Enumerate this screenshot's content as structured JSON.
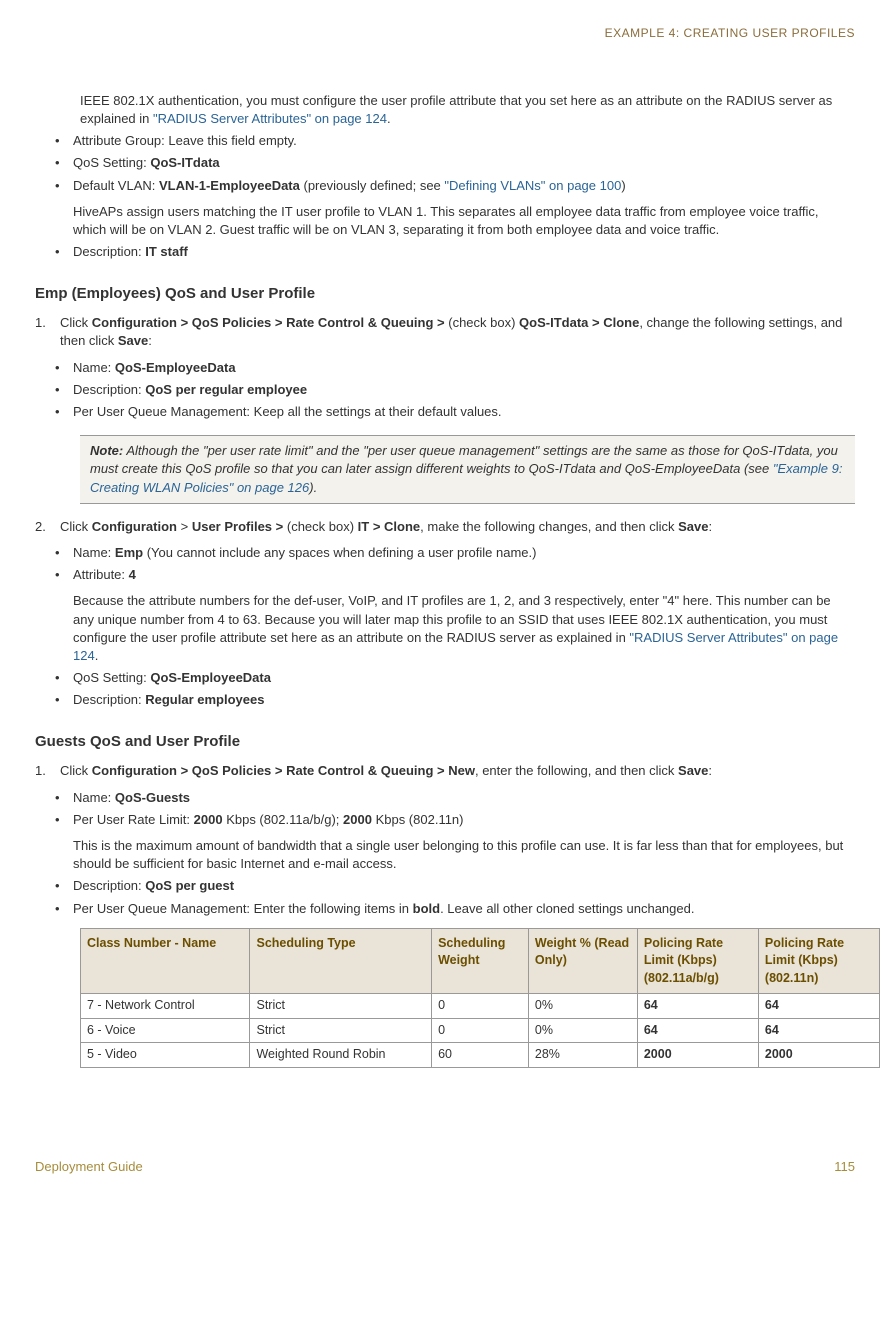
{
  "header": {
    "right": "EXAMPLE 4: CREATING USER PROFILES"
  },
  "intro": {
    "p1a": "IEEE 802.1X authentication, you must configure the user profile attribute that you set here as an attribute on the RADIUS server as explained in ",
    "p1link": "\"RADIUS Server Attributes\" on page 124",
    "p1b": "."
  },
  "bullets1": {
    "b1": "Attribute Group: Leave this field empty.",
    "b2a": "QoS Setting: ",
    "b2b": "QoS-ITdata",
    "b3a": "Default VLAN: ",
    "b3b": "VLAN-1-EmployeeData",
    "b3c": " (previously defined; see ",
    "b3link": "\"Defining VLANs\" on page 100",
    "b3d": ")",
    "b3p": "HiveAPs assign users matching the IT user profile to VLAN 1. This separates all employee data traffic from employee voice traffic, which will be on VLAN 2. Guest traffic will be on VLAN 3, separating it from both employee data and voice traffic.",
    "b4a": "Description: ",
    "b4b": "IT staff"
  },
  "sec1": {
    "title": "Emp (Employees) QoS and User Profile",
    "n1a": "Click ",
    "n1b": "Configuration > QoS Policies > Rate Control & Queuing > ",
    "n1c": "(check box) ",
    "n1d": "QoS-ITdata > Clone",
    "n1e": ", change the following settings, and then click ",
    "n1f": "Save",
    "n1g": ":",
    "s1a": "Name: ",
    "s1b": "QoS-EmployeeData",
    "s2a": "Description: ",
    "s2b": "QoS per regular employee",
    "s3": "Per User Queue Management: Keep all the settings at their default values.",
    "note_label": "Note:",
    "note_a": " Although the \"per user rate limit\" and the \"per user queue management\" settings are the same as those for QoS-ITdata, you must create this QoS profile so that you can later assign different weights to QoS-ITdata and QoS-EmployeeData (see ",
    "note_link": "\"Example 9: Creating WLAN Policies\" on page 126",
    "note_b": ").",
    "n2a": "Click ",
    "n2b": "Configuration",
    "n2c": " > ",
    "n2d": "User Profiles > ",
    "n2e": "(check box) ",
    "n2f": "IT > Clone",
    "n2g": ", make the following changes, and then click ",
    "n2h": "Save",
    "n2i": ":",
    "s4a": "Name: ",
    "s4b": "Emp",
    "s4c": " (You cannot include any spaces when defining a user profile name.)",
    "s5a": "Attribute: ",
    "s5b": "4",
    "s5p_a": "Because the attribute numbers for the def-user, VoIP, and IT profiles are 1, 2, and 3 respectively, enter \"4\" here. This number can be any unique number from 4 to 63. Because you will later map this profile to an SSID that uses IEEE 802.1X authentication, you must configure the user profile attribute set here as an attribute on the RADIUS server as explained in ",
    "s5p_link": "\"RADIUS Server Attributes\" on page 124",
    "s5p_b": ".",
    "s6a": "QoS Setting: ",
    "s6b": "QoS-EmployeeData",
    "s7a": "Description: ",
    "s7b": "Regular employees"
  },
  "sec2": {
    "title": "Guests QoS and User Profile",
    "n1a": "Click ",
    "n1b": "Configuration > QoS Policies > Rate Control & Queuing > New",
    "n1c": ", enter the following, and then click ",
    "n1d": "Save",
    "n1e": ":",
    "s1a": "Name: ",
    "s1b": "QoS-Guests",
    "s2a": "Per User Rate Limit: ",
    "s2b": "2000",
    "s2c": " Kbps (802.11a/b/g); ",
    "s2d": "2000",
    "s2e": " Kbps (802.11n)",
    "s2p": "This is the maximum amount of bandwidth that a single user belonging to this profile can use. It is far less than that for employees, but should be sufficient for basic Internet and e-mail access.",
    "s3a": "Description: ",
    "s3b": "QoS per guest",
    "s4a": "Per User Queue Management: Enter the following items in ",
    "s4b": "bold",
    "s4c": ". Leave all other cloned settings unchanged."
  },
  "table": {
    "h1": "Class Number - Name",
    "h2": "Scheduling Type",
    "h3": "Scheduling Weight",
    "h4": "Weight % (Read Only)",
    "h5": "Policing Rate Limit (Kbps) (802.11a/b/g)",
    "h6": "Policing Rate Limit (Kbps) (802.11n)",
    "r1c1": "7 - Network Control",
    "r1c2": "Strict",
    "r1c3": "0",
    "r1c4": "0%",
    "r1c5": "64",
    "r1c6": "64",
    "r2c1": "6 - Voice",
    "r2c2": "Strict",
    "r2c3": "0",
    "r2c4": "0%",
    "r2c5": "64",
    "r2c6": "64",
    "r3c1": "5 - Video",
    "r3c2": "Weighted Round Robin",
    "r3c3": "60",
    "r3c4": "28%",
    "r3c5": "2000",
    "r3c6": "2000"
  },
  "footer": {
    "left": "Deployment Guide",
    "right": "115"
  }
}
